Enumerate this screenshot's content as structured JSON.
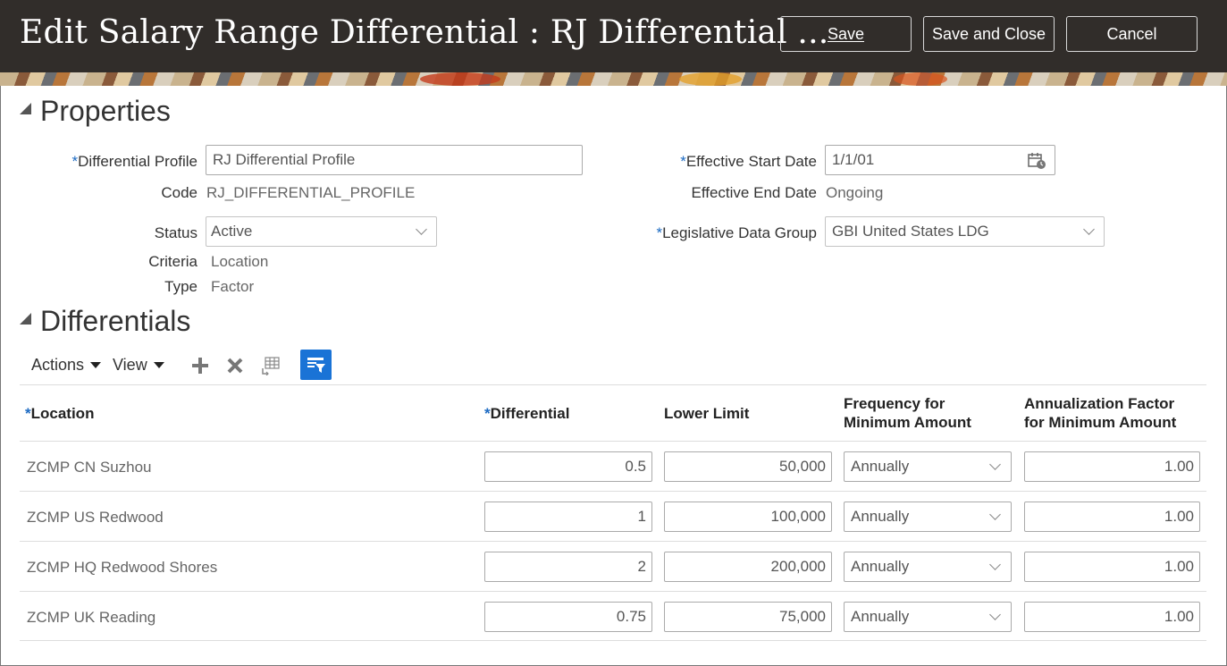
{
  "header": {
    "title": "Edit Salary Range Differential : RJ Differential ...",
    "save_label": "Save",
    "save_close_label": "Save and Close",
    "cancel_label": "Cancel"
  },
  "properties": {
    "section_title": "Properties",
    "differential_profile": {
      "label": "Differential Profile",
      "value": "RJ Differential Profile"
    },
    "code": {
      "label": "Code",
      "value": "RJ_DIFFERENTIAL_PROFILE"
    },
    "status": {
      "label": "Status",
      "value": "Active"
    },
    "criteria": {
      "label": "Criteria",
      "value": "Location"
    },
    "type": {
      "label": "Type",
      "value": "Factor"
    },
    "effective_start_date": {
      "label": "Effective Start Date",
      "value": "1/1/01"
    },
    "effective_end_date": {
      "label": "Effective End Date",
      "value": "Ongoing"
    },
    "legislative_data_group": {
      "label": "Legislative Data Group",
      "value": "GBI United States LDG"
    }
  },
  "differentials": {
    "section_title": "Differentials",
    "toolbar": {
      "actions_label": "Actions",
      "view_label": "View"
    },
    "columns": {
      "location": "Location",
      "differential": "Differential",
      "lower_limit": "Lower Limit",
      "frequency_line1": "Frequency for",
      "frequency_line2": "Minimum Amount",
      "annualization_line1": "Annualization Factor",
      "annualization_line2": "for Minimum Amount"
    },
    "rows": [
      {
        "location": "ZCMP CN Suzhou",
        "differential": "0.5",
        "lower_limit": "50,000",
        "frequency": "Annually",
        "annualization": "1.00"
      },
      {
        "location": "ZCMP US Redwood",
        "differential": "1",
        "lower_limit": "100,000",
        "frequency": "Annually",
        "annualization": "1.00"
      },
      {
        "location": "ZCMP HQ Redwood Shores",
        "differential": "2",
        "lower_limit": "200,000",
        "frequency": "Annually",
        "annualization": "1.00"
      },
      {
        "location": "ZCMP UK Reading",
        "differential": "0.75",
        "lower_limit": "75,000",
        "frequency": "Annually",
        "annualization": "1.00"
      }
    ]
  },
  "colors": {
    "header_bg": "#312d2a",
    "accent": "#1a73d6",
    "required": "#1c6ac2"
  },
  "icons": [
    "add-icon",
    "delete-icon",
    "freeze-columns-icon",
    "query-by-example-icon",
    "calendar-icon",
    "chevron-down-icon",
    "collapse-triangle-icon",
    "dropdown-caret-icon"
  ]
}
